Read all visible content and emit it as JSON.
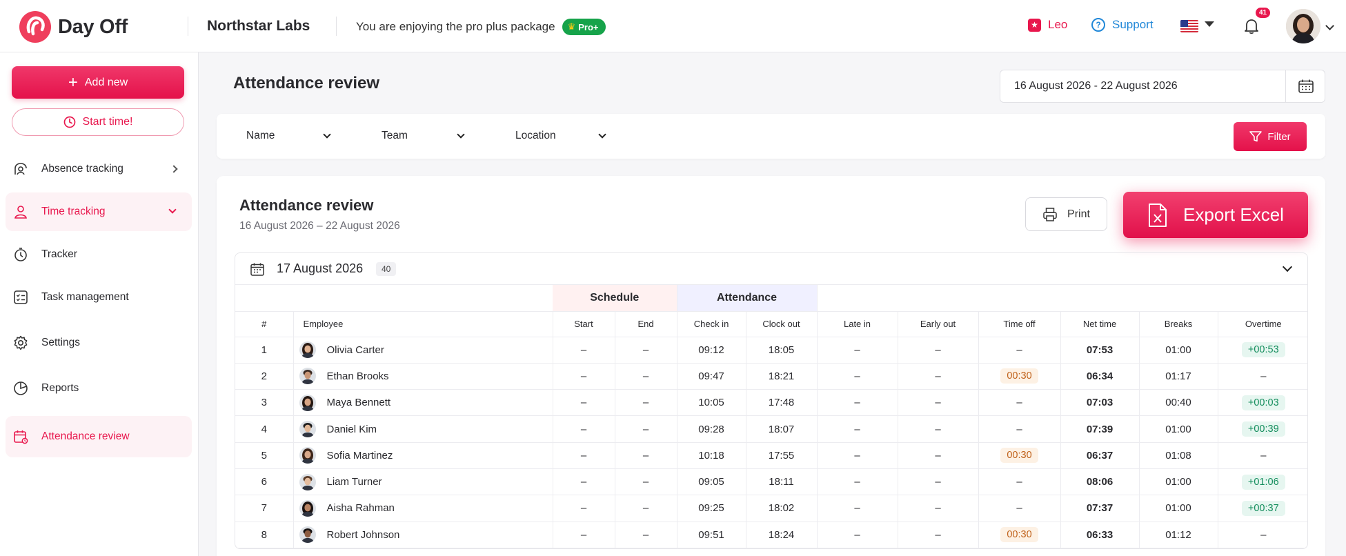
{
  "header": {
    "app_name": "Day Off",
    "company": "Northstar Labs",
    "package_text": "You are enjoying the pro plus package",
    "pro_badge": "Pro+",
    "leo_label": "Leo",
    "support_label": "Support",
    "notification_count": "41"
  },
  "sidebar": {
    "add_new": "Add new",
    "start_time": "Start time!",
    "items": [
      {
        "label": "Absence tracking"
      },
      {
        "label": "Time tracking"
      },
      {
        "label": "Tracker"
      },
      {
        "label": "Task management"
      },
      {
        "label": "Settings"
      },
      {
        "label": "Reports"
      },
      {
        "label": "Attendance review"
      }
    ]
  },
  "main": {
    "title": "Attendance review",
    "date_range": "16 August 2026 - 22 August 2026",
    "filters": {
      "name": "Name",
      "team": "Team",
      "location": "Location",
      "filter_button": "Filter"
    },
    "report": {
      "title": "Attendance review",
      "subtitle": "16 August 2026 – 22 August 2026",
      "print": "Print",
      "export": "Export Excel",
      "day": {
        "label": "17 August 2026",
        "count": "40"
      },
      "groups": {
        "schedule": "Schedule",
        "attendance": "Attendance"
      },
      "columns": [
        "#",
        "Employee",
        "Start",
        "End",
        "Check in",
        "Clock out",
        "Late in",
        "Early out",
        "Time off",
        "Net time",
        "Breaks",
        "Overtime"
      ],
      "rows": [
        {
          "n": "1",
          "name": "Olivia Carter",
          "start": "–",
          "end": "–",
          "in": "09:12",
          "out": "18:05",
          "late": "–",
          "early": "–",
          "off": "–",
          "net": "07:53",
          "breaks": "01:00",
          "ot": "+00:53"
        },
        {
          "n": "2",
          "name": "Ethan Brooks",
          "start": "–",
          "end": "–",
          "in": "09:47",
          "out": "18:21",
          "late": "–",
          "early": "–",
          "off": "00:30",
          "net": "06:34",
          "breaks": "01:17",
          "ot": "–"
        },
        {
          "n": "3",
          "name": "Maya Bennett",
          "start": "–",
          "end": "–",
          "in": "10:05",
          "out": "17:48",
          "late": "–",
          "early": "–",
          "off": "–",
          "net": "07:03",
          "breaks": "00:40",
          "ot": "+00:03"
        },
        {
          "n": "4",
          "name": "Daniel Kim",
          "start": "–",
          "end": "–",
          "in": "09:28",
          "out": "18:07",
          "late": "–",
          "early": "–",
          "off": "–",
          "net": "07:39",
          "breaks": "01:00",
          "ot": "+00:39"
        },
        {
          "n": "5",
          "name": "Sofia Martinez",
          "start": "–",
          "end": "–",
          "in": "10:18",
          "out": "17:55",
          "late": "–",
          "early": "–",
          "off": "00:30",
          "net": "06:37",
          "breaks": "01:08",
          "ot": "–"
        },
        {
          "n": "6",
          "name": "Liam Turner",
          "start": "–",
          "end": "–",
          "in": "09:05",
          "out": "18:11",
          "late": "–",
          "early": "–",
          "off": "–",
          "net": "08:06",
          "breaks": "01:00",
          "ot": "+01:06"
        },
        {
          "n": "7",
          "name": "Aisha Rahman",
          "start": "–",
          "end": "–",
          "in": "09:25",
          "out": "18:02",
          "late": "–",
          "early": "–",
          "off": "–",
          "net": "07:37",
          "breaks": "01:00",
          "ot": "+00:37"
        },
        {
          "n": "8",
          "name": "Robert Johnson",
          "start": "–",
          "end": "–",
          "in": "09:51",
          "out": "18:24",
          "late": "–",
          "early": "–",
          "off": "00:30",
          "net": "06:33",
          "breaks": "01:12",
          "ot": "–"
        }
      ]
    }
  },
  "colors": {
    "brand": "#e8174d",
    "support": "#2188d8",
    "pro": "#16a34a"
  },
  "icons": [
    "logo-icon",
    "crown-icon",
    "star-icon",
    "help-icon",
    "us-flag-icon",
    "bell-icon",
    "plus-icon",
    "clock-icon",
    "absence-icon",
    "time-tracking-icon",
    "stopwatch-icon",
    "task-icon",
    "gear-icon",
    "reports-icon",
    "attendance-icon",
    "calendar-icon",
    "filter-icon",
    "printer-icon",
    "excel-file-icon"
  ]
}
